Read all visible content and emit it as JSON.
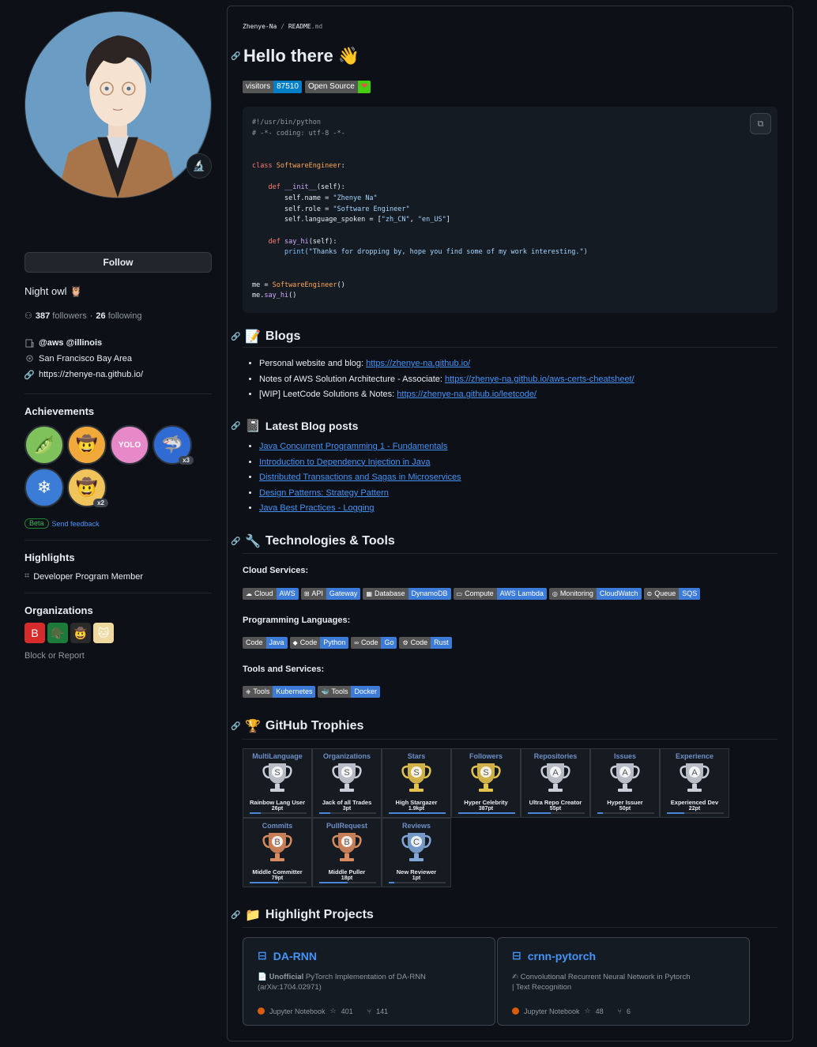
{
  "profile": {
    "status_emoji": "🔬",
    "follow_label": "Follow",
    "bio": "Night owl 🦉",
    "followers_count": "387",
    "followers_label": "followers",
    "separator": "·",
    "following_count": "26",
    "following_label": "following",
    "company": "@aws @illinois",
    "location": "San Francisco Bay Area",
    "website": "https://zhenye-na.github.io/"
  },
  "achievements": {
    "title": "Achievements",
    "items": [
      {
        "name": "pair-extraordinaire",
        "emoji": "🫛",
        "color": "#7fc15a",
        "count": ""
      },
      {
        "name": "starstruck",
        "emoji": "🤠",
        "color": "#f2a93b",
        "count": ""
      },
      {
        "name": "yolo",
        "emoji": "YOLO",
        "color": "#e789c8",
        "count": ""
      },
      {
        "name": "pull-shark",
        "emoji": "🦈",
        "color": "#2f6bd3",
        "count": "x3"
      },
      {
        "name": "arctic-code-vault",
        "emoji": "❄",
        "color": "#3b7dd6",
        "count": ""
      },
      {
        "name": "quickdraw",
        "emoji": "🤠",
        "color": "#f0c35b",
        "count": "x2"
      }
    ],
    "beta_label": "Beta",
    "feedback_label": "Send feedback"
  },
  "highlights": {
    "title": "Highlights",
    "item": "Developer Program Member"
  },
  "organizations": {
    "title": "Organizations",
    "items": [
      {
        "name": "org-1",
        "glyph": "B",
        "color": "#d62b2b"
      },
      {
        "name": "org-2",
        "glyph": "🪖",
        "color": "#1d7a3a"
      },
      {
        "name": "org-3",
        "glyph": "🤠",
        "color": "#2a2a2a"
      },
      {
        "name": "org-4",
        "glyph": "🐱",
        "color": "#f0d9a0"
      }
    ],
    "block_label": "Block or Report"
  },
  "readme": {
    "crumb_user": "Zhenye-Na",
    "crumb_sep": "/",
    "crumb_file": "README",
    "crumb_ext": ".md",
    "title": "Hello there 👋",
    "badge_visitors_label": "visitors",
    "badge_visitors_value": "87510",
    "badge_os_label": "Open Source",
    "badge_os_value": "❤",
    "code": {
      "l1": "#!/usr/bin/python",
      "l2": "# -*- coding: utf-8 -*-",
      "class_kw": "class",
      "class_name": "SoftwareEngineer",
      "def_kw": "def",
      "init_name": "__init__",
      "init_args": "(self):",
      "name_lhs": "self.name = ",
      "name_val": "\"Zhenye Na\"",
      "role_lhs": "self.role = ",
      "role_val": "\"Software Engineer\"",
      "lang_lhs": "self.language_spoken = [",
      "lang_v1": "\"zh_CN\"",
      "lang_sep": ", ",
      "lang_v2": "\"en_US\"",
      "lang_end": "]",
      "sayhi_name": "say_hi",
      "sayhi_args": "(self):",
      "print_kw": "print",
      "print_str": "(\"Thanks for dropping by, hope you find some of my work interesting.\")",
      "me_lhs": "me = ",
      "me_rhs": "SoftwareEngineer",
      "me_paren": "()",
      "call_obj": "me.",
      "call_fn": "say_hi",
      "call_paren": "()"
    },
    "blogs": {
      "title": "Blogs",
      "icon": "📝",
      "items": [
        {
          "prefix": "Personal website and blog: ",
          "link": "https://zhenye-na.github.io/"
        },
        {
          "prefix": "Notes of AWS Solution Architecture - Associate: ",
          "link": "https://zhenye-na.github.io/aws-certs-cheatsheet/"
        },
        {
          "prefix": "[WIP] LeetCode Solutions & Notes: ",
          "link": "https://zhenye-na.github.io/leetcode/"
        }
      ]
    },
    "latest": {
      "title": "Latest Blog posts",
      "icon": "📓",
      "items": [
        "Java Concurrent Programming 1 - Fundamentals",
        "Introduction to Dependency Injection in Java",
        "Distributed Transactions and Sagas in Microservices",
        "Design Patterns: Strategy Pattern",
        "Java Best Practices - Logging"
      ]
    },
    "tech": {
      "title": "Technologies & Tools",
      "icon": "🔧",
      "cloud_title": "Cloud Services:",
      "cloud": [
        {
          "icon": "☁",
          "label": "Cloud",
          "value": "AWS"
        },
        {
          "icon": "⊞",
          "label": "API",
          "value": "Gateway"
        },
        {
          "icon": "▦",
          "label": "Database",
          "value": "DynamoDB"
        },
        {
          "icon": "▭",
          "label": "Compute",
          "value": "AWS Lambda"
        },
        {
          "icon": "◎",
          "label": "Monitoring",
          "value": "CloudWatch"
        },
        {
          "icon": "⊜",
          "label": "Queue",
          "value": "SQS"
        }
      ],
      "lang_title": "Programming Languages:",
      "langs": [
        {
          "icon": "",
          "label": "Code",
          "value": "Java"
        },
        {
          "icon": "◆",
          "label": "Code",
          "value": "Python"
        },
        {
          "icon": "∞",
          "label": "Code",
          "value": "Go"
        },
        {
          "icon": "⚙",
          "label": "Code",
          "value": "Rust"
        }
      ],
      "tools_title": "Tools and Services:",
      "tools": [
        {
          "icon": "⎈",
          "label": "Tools",
          "value": "Kubernetes"
        },
        {
          "icon": "🐳",
          "label": "Tools",
          "value": "Docker"
        }
      ]
    },
    "trophies": {
      "title": "GitHub Trophies",
      "icon": "🏆",
      "items": [
        {
          "title": "MultiLanguage",
          "rank": "S",
          "name": "Rainbow Lang User",
          "points": "26pt",
          "progress": 0.2,
          "color": "#c9ced8"
        },
        {
          "title": "Organizations",
          "rank": "S",
          "name": "Jack of all Trades",
          "points": "3pt",
          "progress": 0.2,
          "color": "#c9ced8"
        },
        {
          "title": "Stars",
          "rank": "S",
          "name": "High Stargazer",
          "points": "1.9kpt",
          "progress": 1.0,
          "color": "#e4c24e"
        },
        {
          "title": "Followers",
          "rank": "S",
          "name": "Hyper Celebrity",
          "points": "387pt",
          "progress": 1.0,
          "color": "#e4c24e"
        },
        {
          "title": "Repositories",
          "rank": "A",
          "name": "Ultra Repo Creator",
          "points": "55pt",
          "progress": 0.4,
          "color": "#c9ced8"
        },
        {
          "title": "Issues",
          "rank": "A",
          "name": "Hyper Issuer",
          "points": "50pt",
          "progress": 0.1,
          "color": "#c9ced8"
        },
        {
          "title": "Experience",
          "rank": "A",
          "name": "Experienced Dev",
          "points": "22pt",
          "progress": 0.3,
          "color": "#c9ced8"
        },
        {
          "title": "Commits",
          "rank": "B",
          "name": "Middle Committer",
          "points": "79pt",
          "progress": 0.5,
          "color": "#d98a5e"
        },
        {
          "title": "PullRequest",
          "rank": "B",
          "name": "Middle Puller",
          "points": "18pt",
          "progress": 0.5,
          "color": "#d98a5e"
        },
        {
          "title": "Reviews",
          "rank": "C",
          "name": "New Reviewer",
          "points": "1pt",
          "progress": 0.1,
          "color": "#7fa7d8"
        }
      ]
    },
    "projects": {
      "title": "Highlight Projects",
      "icon": "📁",
      "items": [
        {
          "name": "DA-RNN",
          "desc_icon": "📄",
          "desc_bold": "𝐔𝐧𝐨𝐟𝐟𝐢𝐜𝐢𝐚𝐥",
          "desc": " PyTorch Implementation of DA-RNN",
          "desc2": "(arXiv:1704.02971)",
          "lang": "Jupyter Notebook",
          "stars": "401",
          "forks": "141"
        },
        {
          "name": "crnn-pytorch",
          "desc_icon": "✍",
          "desc_bold": "",
          "desc": " Convolutional Recurrent Neural Network in Pytorch",
          "desc2": "| Text Recognition",
          "lang": "Jupyter Notebook",
          "stars": "48",
          "forks": "6"
        }
      ]
    }
  }
}
